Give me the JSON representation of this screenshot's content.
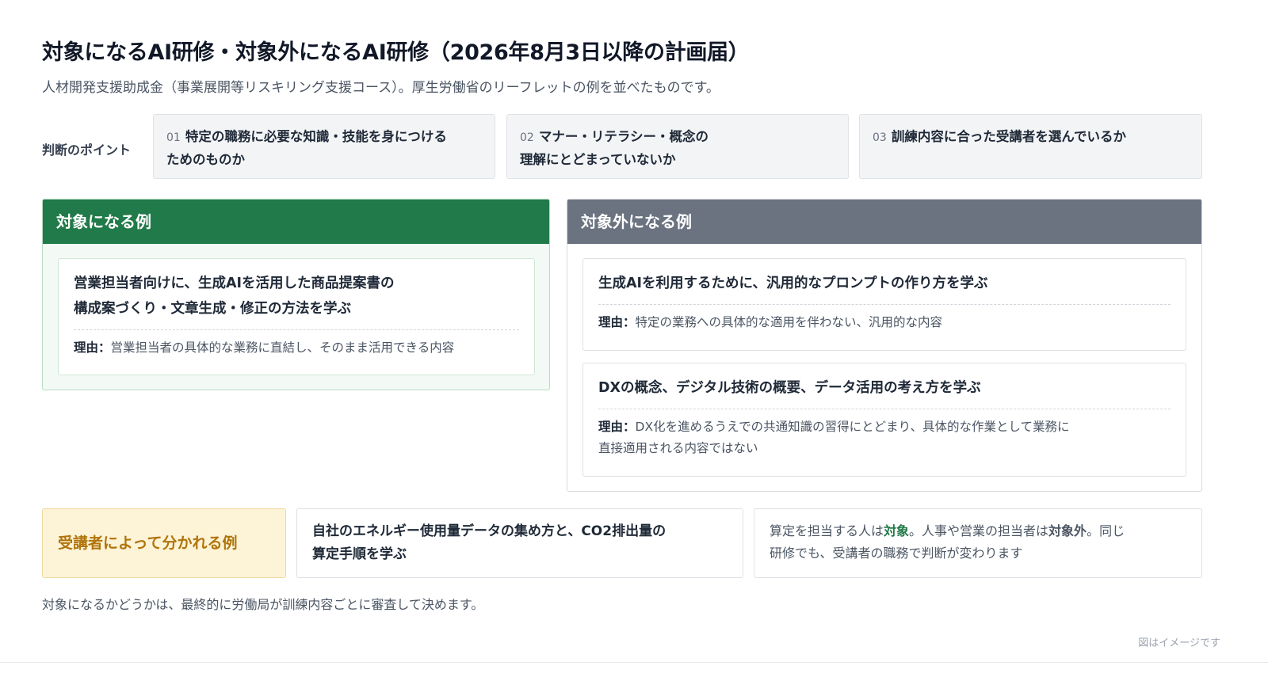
{
  "title": "対象になるAI研修・対象外になるAI研修（2026年8月3日以降の計画届）",
  "subtitle": "人材開発支援助成金（事業展開等リスキリング支援コース）。厚生労働省のリーフレットの例を並べたものです。",
  "points": {
    "label": "判断のポイント",
    "items": [
      {
        "num": "01",
        "line1": "特定の職務に必要な知識・技能を身につける",
        "line2": "ためのものか"
      },
      {
        "num": "02",
        "line1": "マナー・リテラシー・概念の",
        "line2": "理解にとどまっていないか"
      },
      {
        "num": "03",
        "line1": "訓練内容に合った受講者を選んでいるか",
        "line2": ""
      }
    ]
  },
  "eligible": {
    "heading": "対象になる例",
    "cards": [
      {
        "title_line1": "営業担当者向けに、生成AIを活用した商品提案書の",
        "title_line2": "構成案づくり・文章生成・修正の方法を学ぶ",
        "reason_label": "理由：",
        "reason": "営業担当者の具体的な業務に直結し、そのまま活用できる内容",
        "reason_line2": ""
      }
    ]
  },
  "ineligible": {
    "heading": "対象外になる例",
    "cards": [
      {
        "title_line1": "生成AIを利用するために、汎用的なプロンプトの作り方を学ぶ",
        "title_line2": "",
        "reason_label": "理由：",
        "reason": "特定の業務への具体的な適用を伴わない、汎用的な内容",
        "reason_line2": ""
      },
      {
        "title_line1": "DXの概念、デジタル技術の概要、データ活用の考え方を学ぶ",
        "title_line2": "",
        "reason_label": "理由：",
        "reason": "DX化を進めるうえでの共通知識の習得にとどまり、具体的な作業として業務に",
        "reason_line2": "直接適用される内容ではない"
      }
    ]
  },
  "split": {
    "label": "受講者によって分かれる例",
    "example_line1": "自社のエネルギー使用量データの集め方と、CO2排出量の",
    "example_line2": "算定手順を学ぶ",
    "note_part1": "算定を担当する人は",
    "note_target": "対象",
    "note_part2": "。人事や営業の担当者は",
    "note_excluded": "対象外",
    "note_part3": "。同じ",
    "note_line2": "研修でも、受講者の職務で判断が変わります"
  },
  "footnote": "対象になるかどうかは、最終的に労働局が訓練内容ごとに審査して決めます。",
  "image_note": "図はイメージです",
  "colors": {
    "eligible_header": "#217a49",
    "ineligible_header": "#6b7280",
    "split_accent": "#b0740a",
    "split_bg": "#fdf3d7"
  }
}
